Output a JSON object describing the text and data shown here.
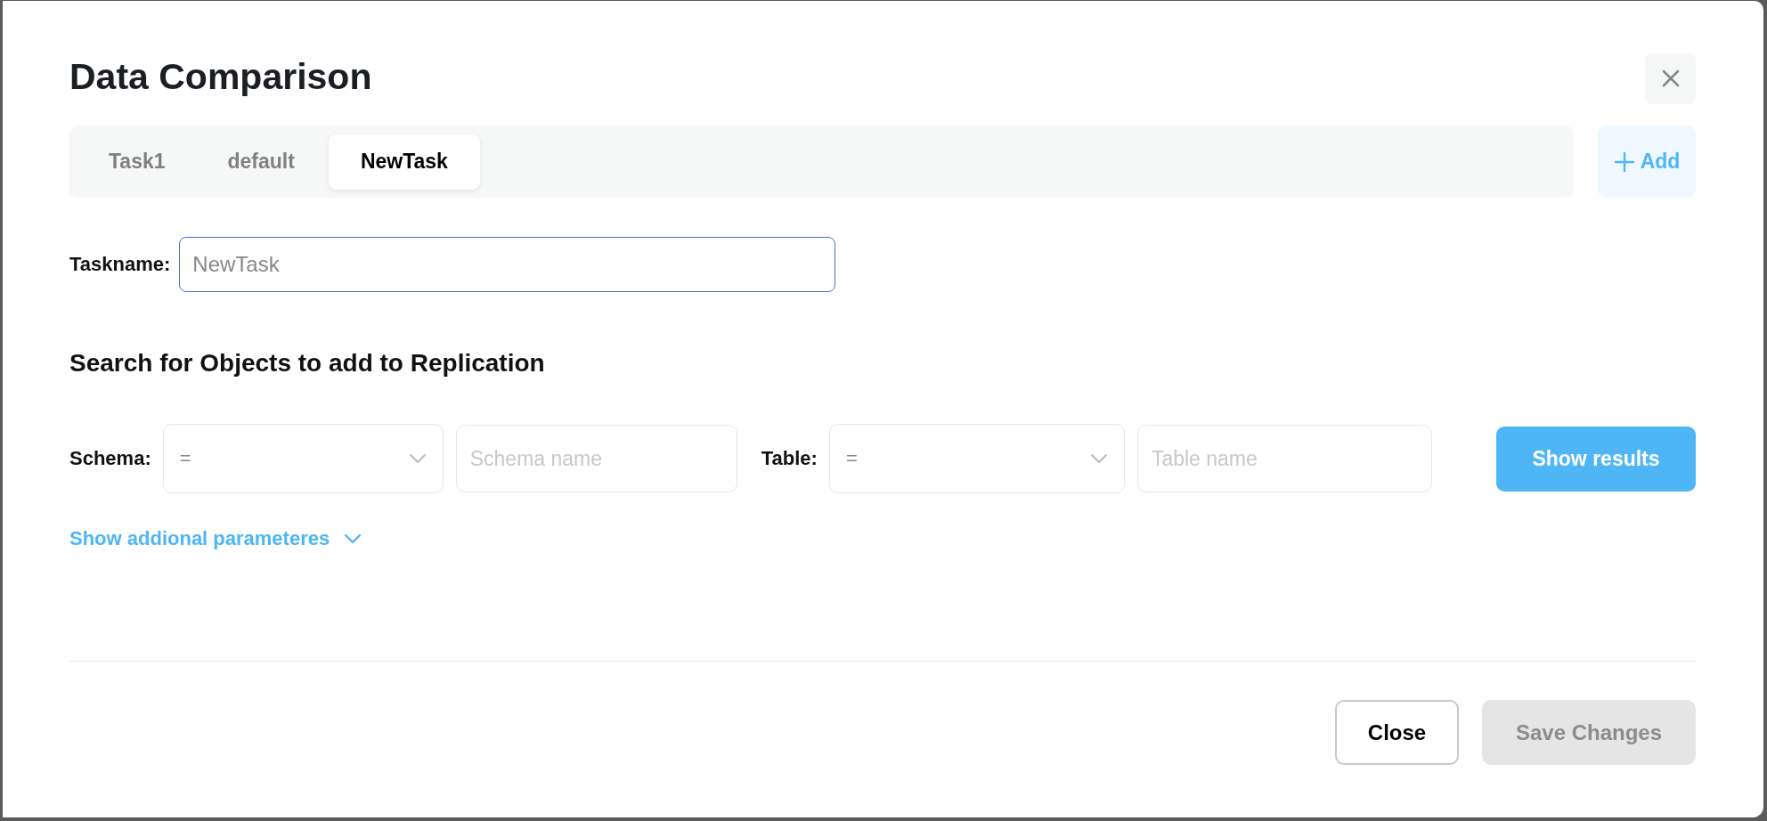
{
  "dialog": {
    "title": "Data Comparison"
  },
  "tabs": [
    {
      "label": "Task1",
      "selected": false
    },
    {
      "label": "default",
      "selected": false
    },
    {
      "label": "NewTask",
      "selected": true
    }
  ],
  "add_button": {
    "label": "Add"
  },
  "taskname": {
    "label": "Taskname:",
    "value": "NewTask"
  },
  "search": {
    "heading": "Search for Objects to add to Replication",
    "filters": [
      {
        "label": "Schema:",
        "operator": "=",
        "placeholder": "Schema name"
      },
      {
        "label": "Table:",
        "operator": "=",
        "placeholder": "Table name"
      }
    ],
    "show_results": {
      "label": "Show results"
    },
    "more_link": {
      "label": "Show addional parameteres"
    }
  },
  "footer": {
    "buttons": [
      {
        "label": "Close",
        "kind": "secondary",
        "disabled": false
      },
      {
        "label": "Save Changes",
        "kind": "primary",
        "disabled": true
      }
    ]
  }
}
